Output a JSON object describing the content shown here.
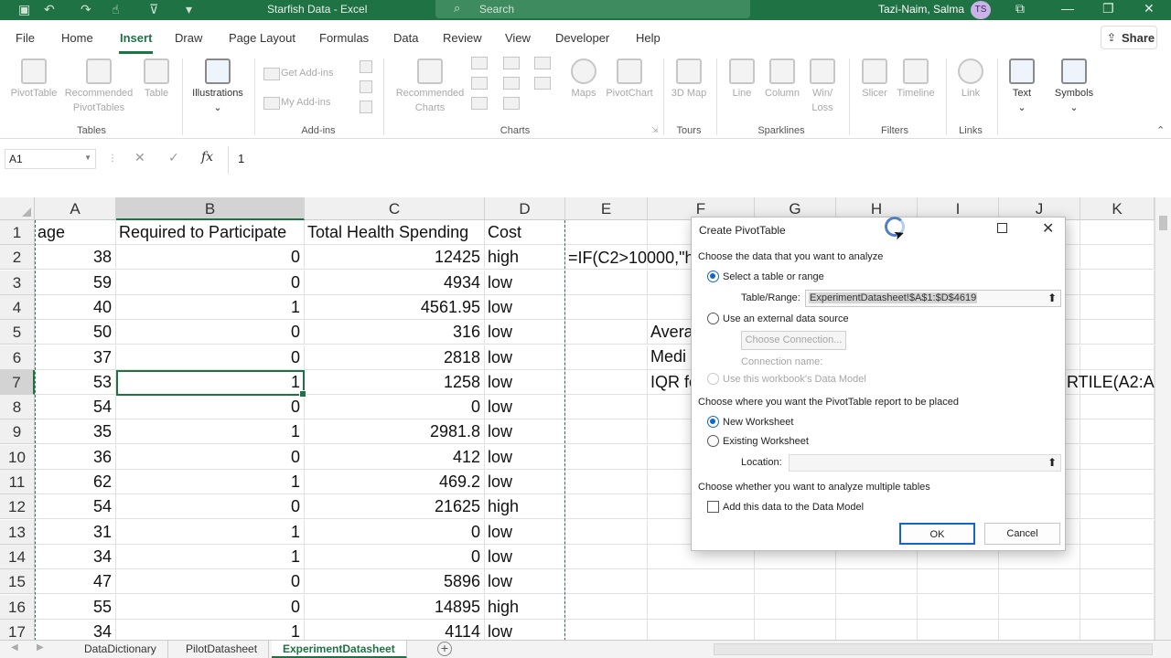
{
  "app": {
    "doc_title": "Starfish Data  -  Excel",
    "search_placeholder": "Search",
    "user_name": "Tazi-Naim, Salma",
    "user_initials": "TS",
    "theme_color": "#1f7244"
  },
  "menu": {
    "tabs": [
      "File",
      "Home",
      "Insert",
      "Draw",
      "Page Layout",
      "Formulas",
      "Data",
      "Review",
      "View",
      "Developer",
      "Help"
    ],
    "active_tab": "Insert",
    "share_label": "Share"
  },
  "ribbon": {
    "pivot_table": "PivotTable",
    "recommended_pivot": "Recommended PivotTables",
    "table": "Table",
    "tables_group": "Tables",
    "illustrations": "Illustrations",
    "get_addins": "Get Add-ins",
    "my_addins": "My Add-ins",
    "addins_group": "Add-ins",
    "recommended_charts": "Recommended Charts",
    "maps": "Maps",
    "pivot_chart": "PivotChart",
    "charts_group": "Charts",
    "map_3d": "3D Map",
    "tours_group": "Tours",
    "line": "Line",
    "column": "Column",
    "win_loss": "Win/ Loss",
    "sparklines_group": "Sparklines",
    "slicer": "Slicer",
    "timeline": "Timeline",
    "filters_group": "Filters",
    "link": "Link",
    "links_group": "Links",
    "text": "Text",
    "symbols": "Symbols"
  },
  "formula_bar": {
    "name_box": "A1",
    "fx": "fx",
    "formula": "1"
  },
  "grid": {
    "columns": [
      "A",
      "B",
      "C",
      "D",
      "E",
      "F",
      "G",
      "H",
      "I",
      "J",
      "K"
    ],
    "rows": [
      {
        "n": "1",
        "a": "age",
        "b": "Required to Participate",
        "c": "Total Health Spending",
        "d": "Cost"
      },
      {
        "n": "2",
        "a": "38",
        "b": "0",
        "c": "12425",
        "d": "high"
      },
      {
        "n": "3",
        "a": "59",
        "b": "0",
        "c": "4934",
        "d": "low"
      },
      {
        "n": "4",
        "a": "40",
        "b": "1",
        "c": "4561.95",
        "d": "low"
      },
      {
        "n": "5",
        "a": "50",
        "b": "0",
        "c": "316",
        "d": "low"
      },
      {
        "n": "6",
        "a": "37",
        "b": "0",
        "c": "2818",
        "d": "low"
      },
      {
        "n": "7",
        "a": "53",
        "b": "1",
        "c": "1258",
        "d": "low"
      },
      {
        "n": "8",
        "a": "54",
        "b": "0",
        "c": "0",
        "d": "low"
      },
      {
        "n": "9",
        "a": "35",
        "b": "1",
        "c": "2981.8",
        "d": "low"
      },
      {
        "n": "10",
        "a": "36",
        "b": "0",
        "c": "412",
        "d": "low"
      },
      {
        "n": "11",
        "a": "62",
        "b": "1",
        "c": "469.2",
        "d": "low"
      },
      {
        "n": "12",
        "a": "54",
        "b": "0",
        "c": "21625",
        "d": "high"
      },
      {
        "n": "13",
        "a": "31",
        "b": "1",
        "c": "0",
        "d": "low"
      },
      {
        "n": "14",
        "a": "34",
        "b": "1",
        "c": "0",
        "d": "low"
      },
      {
        "n": "15",
        "a": "47",
        "b": "0",
        "c": "5896",
        "d": "low"
      },
      {
        "n": "16",
        "a": "55",
        "b": "0",
        "c": "14895",
        "d": "high"
      },
      {
        "n": "17",
        "a": "34",
        "b": "1",
        "c": "4114",
        "d": "low"
      }
    ],
    "e2_formula": "=IF(C2>10000,\"h",
    "f5": "Avera",
    "f6": "Medi",
    "f7": "IQR fo",
    "j7": "RTILE(A2:A"
  },
  "sheets": [
    "DataDictionary",
    "PilotDatasheet",
    "ExperimentDatasheet"
  ],
  "active_sheet": "ExperimentDatasheet",
  "dialog": {
    "title": "Create PivotTable",
    "section1": "Choose the data that you want to analyze",
    "select_table": "Select a table or range",
    "table_range_label": "Table/Range:",
    "table_range_value": "ExperimentDatasheet!$A$1:$D$4619",
    "external_source": "Use an external data source",
    "choose_connection": "Choose Connection...",
    "connection_name": "Connection name:",
    "data_model_src": "Use this workbook's Data Model",
    "section2": "Choose where you want the PivotTable report to be placed",
    "new_worksheet": "New Worksheet",
    "existing_worksheet": "Existing Worksheet",
    "location_label": "Location:",
    "section3": "Choose whether you want to analyze multiple tables",
    "add_data_model": "Add this data to the Data Model",
    "ok": "OK",
    "cancel": "Cancel"
  }
}
